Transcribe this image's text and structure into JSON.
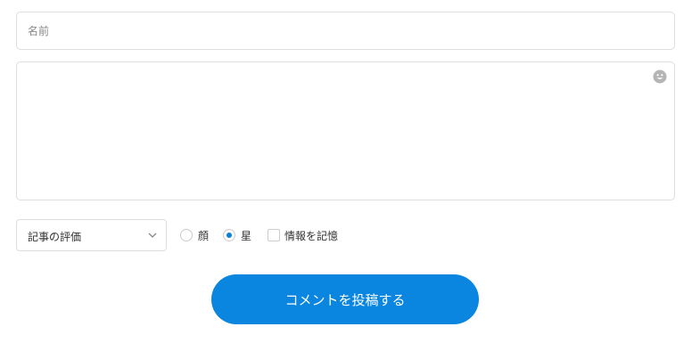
{
  "form": {
    "name_placeholder": "名前",
    "comment_value": "",
    "emoji_icon": "smiley-face-icon",
    "rating_select": {
      "selected": "記事の評価"
    },
    "rating_style": {
      "options": [
        "顔",
        "星"
      ],
      "selected": "星"
    },
    "remember_label": "情報を記憶",
    "remember_checked": false,
    "submit_label": "コメントを投稿する"
  },
  "colors": {
    "accent": "#0a85e0",
    "border": "#dddddd",
    "placeholder": "#888888"
  }
}
